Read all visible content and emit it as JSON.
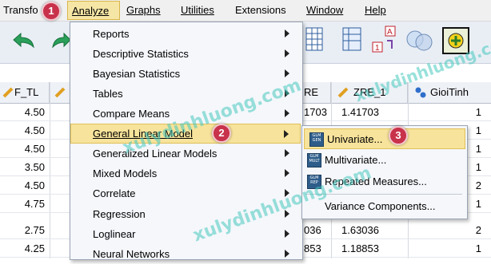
{
  "menubar": {
    "items": [
      "Transfo",
      "Analyze",
      "Graphs",
      "Utilities",
      "Extensions",
      "Window",
      "Help"
    ],
    "underline_letters": [
      "",
      "A",
      "G",
      "U",
      "x",
      "W",
      "H"
    ]
  },
  "badges": [
    "1",
    "2",
    "3"
  ],
  "grid": {
    "headers": [
      "F_TL",
      "RE",
      "ZRE_1",
      "GioiTinh"
    ],
    "rows": [
      {
        "c1": "4.50",
        "c2": "1703",
        "c3": "1.41703",
        "c4": "1"
      },
      {
        "c1": "4.50",
        "c2": "",
        "c3": "",
        "c4": "1"
      },
      {
        "c1": "4.50",
        "c2": "",
        "c3": "",
        "c4": "1"
      },
      {
        "c1": "3.50",
        "c2": "",
        "c3": "",
        "c4": "1"
      },
      {
        "c1": "4.50",
        "c2": "",
        "c3": "",
        "c4": "2"
      },
      {
        "c1": "4.75",
        "c2": "",
        "c3": "",
        "c4": "1"
      },
      {
        "c1": "2.75",
        "c2": "036",
        "c3": "1.63036",
        "c4": "2"
      },
      {
        "c1": "4.25",
        "c2": "853",
        "c3": "1.18853",
        "c4": "1"
      }
    ]
  },
  "analyze_menu": [
    "Reports",
    "Descriptive Statistics",
    "Bayesian Statistics",
    "Tables",
    "Compare Means",
    "General Linear Model",
    "Generalized Linear Models",
    "Mixed Models",
    "Correlate",
    "Regression",
    "Loglinear",
    "Neural Networks"
  ],
  "glm_submenu": [
    {
      "label": "Univariate...",
      "icon": "GLM GEN"
    },
    {
      "label": "Multivariate...",
      "icon": "GLM MULT"
    },
    {
      "label": "Repeated Measures...",
      "icon": "GLM REP"
    },
    {
      "label": "Variance Components...",
      "icon": ""
    }
  ],
  "watermark": "xulydinhluong.com",
  "colors": {
    "highlight": "#f7e39b",
    "badge": "#c8324b",
    "menu_bg": "#f5f7fb"
  }
}
